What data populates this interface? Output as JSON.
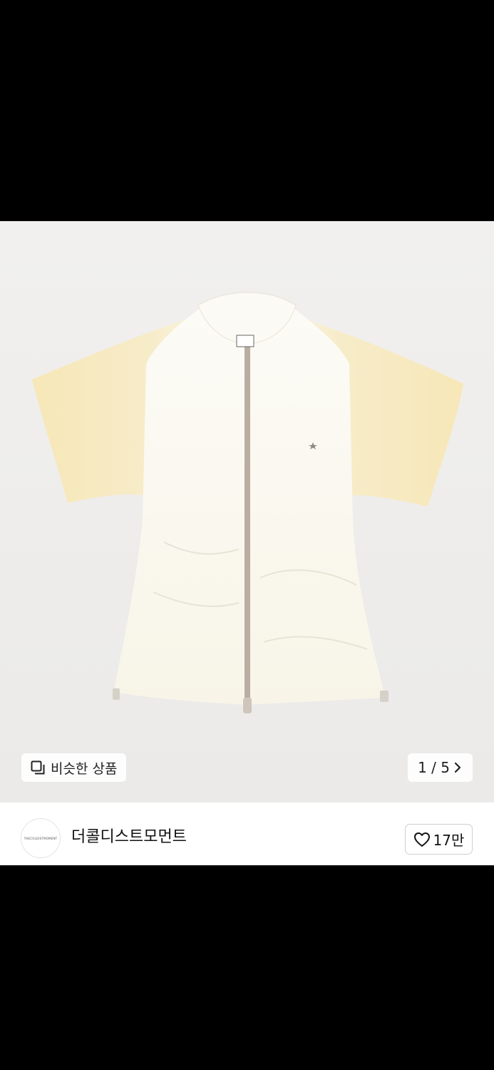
{
  "gallery": {
    "similar_label": "비슷한 상품",
    "counter": "1 / 5",
    "icons": {
      "similar": "copy-icon",
      "next": "chevron-right-icon"
    },
    "image_alt": "short-sleeve zip jacket",
    "colors": {
      "background": "#efeeec",
      "body": "#fbf8ee",
      "sleeve": "#f7ebc6",
      "zipper": "#b9aea1"
    }
  },
  "shop": {
    "avatar_text": "THECOLDISTMOMENT",
    "name": "더콜디스트모먼트",
    "likes": "17만",
    "icons": {
      "like": "heart-icon"
    }
  }
}
